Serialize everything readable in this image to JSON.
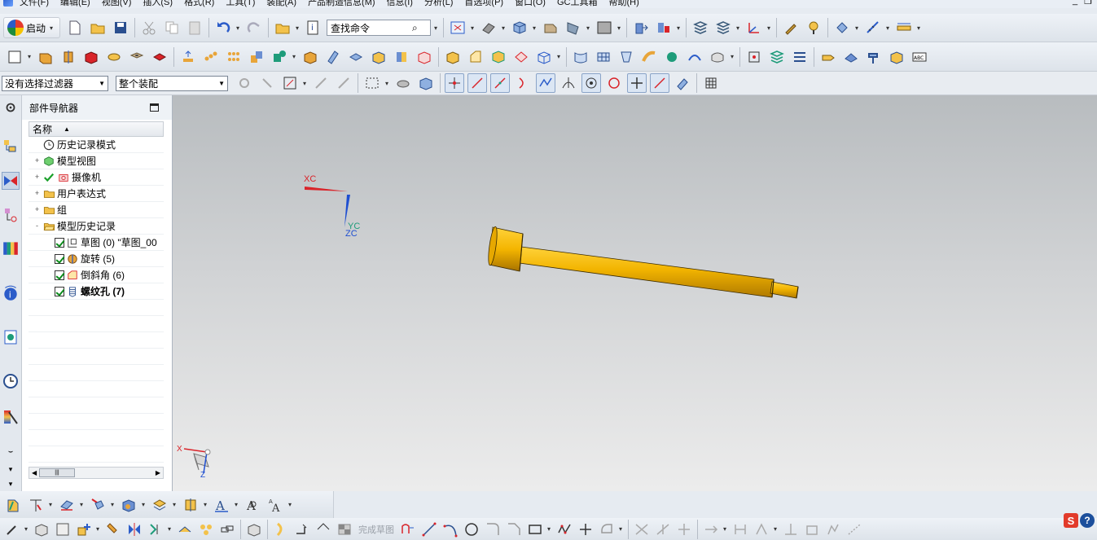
{
  "menubar": {
    "items": [
      "文件(F)",
      "编辑(E)",
      "视图(V)",
      "插入(S)",
      "格式(R)",
      "工具(T)",
      "装配(A)",
      "产品制造信息(M)",
      "信息(I)",
      "分析(L)",
      "首选项(P)",
      "窗口(O)",
      "GC工具箱",
      "帮助(H)"
    ]
  },
  "toolbar": {
    "start_label": "启动",
    "search_placeholder": "查找命令"
  },
  "selection_bar": {
    "filter_value": "没有选择过滤器",
    "scope_value": "整个装配"
  },
  "navigator": {
    "title": "部件导航器",
    "column_name": "名称",
    "items": [
      {
        "label": "历史记录模式",
        "icon": "clock-icon",
        "expand": ""
      },
      {
        "label": "模型视图",
        "icon": "model-view-icon",
        "expand": "+"
      },
      {
        "label": "摄像机",
        "icon": "camera-icon",
        "expand": "+"
      },
      {
        "label": "用户表达式",
        "icon": "folder-icon",
        "expand": "+"
      },
      {
        "label": "组",
        "icon": "folder-icon",
        "expand": "+"
      },
      {
        "label": "模型历史记录",
        "icon": "folder-open-icon",
        "expand": "-"
      },
      {
        "label": "草图 (0) \"草图_00",
        "icon": "sketch-icon",
        "checked": true
      },
      {
        "label": "旋转 (5)",
        "icon": "revolve-icon",
        "checked": true
      },
      {
        "label": "倒斜角 (6)",
        "icon": "chamfer-icon",
        "checked": true
      },
      {
        "label": "螺纹孔 (7)",
        "icon": "threaded-hole-icon",
        "checked": true,
        "bold": true
      }
    ]
  },
  "viewport": {
    "wcs": {
      "x_label": "XC",
      "y_label": "YC",
      "z_label": "ZC"
    },
    "triad": {
      "x_label": "X",
      "z_label": "Z"
    },
    "part_color": "#f2b400"
  },
  "bottom_toolbar": {
    "finish_sketch_label": "完成草图"
  },
  "colors": {
    "accent": "#2b5cc9",
    "axis_x": "#d9242a",
    "axis_z": "#1f4fd1"
  }
}
